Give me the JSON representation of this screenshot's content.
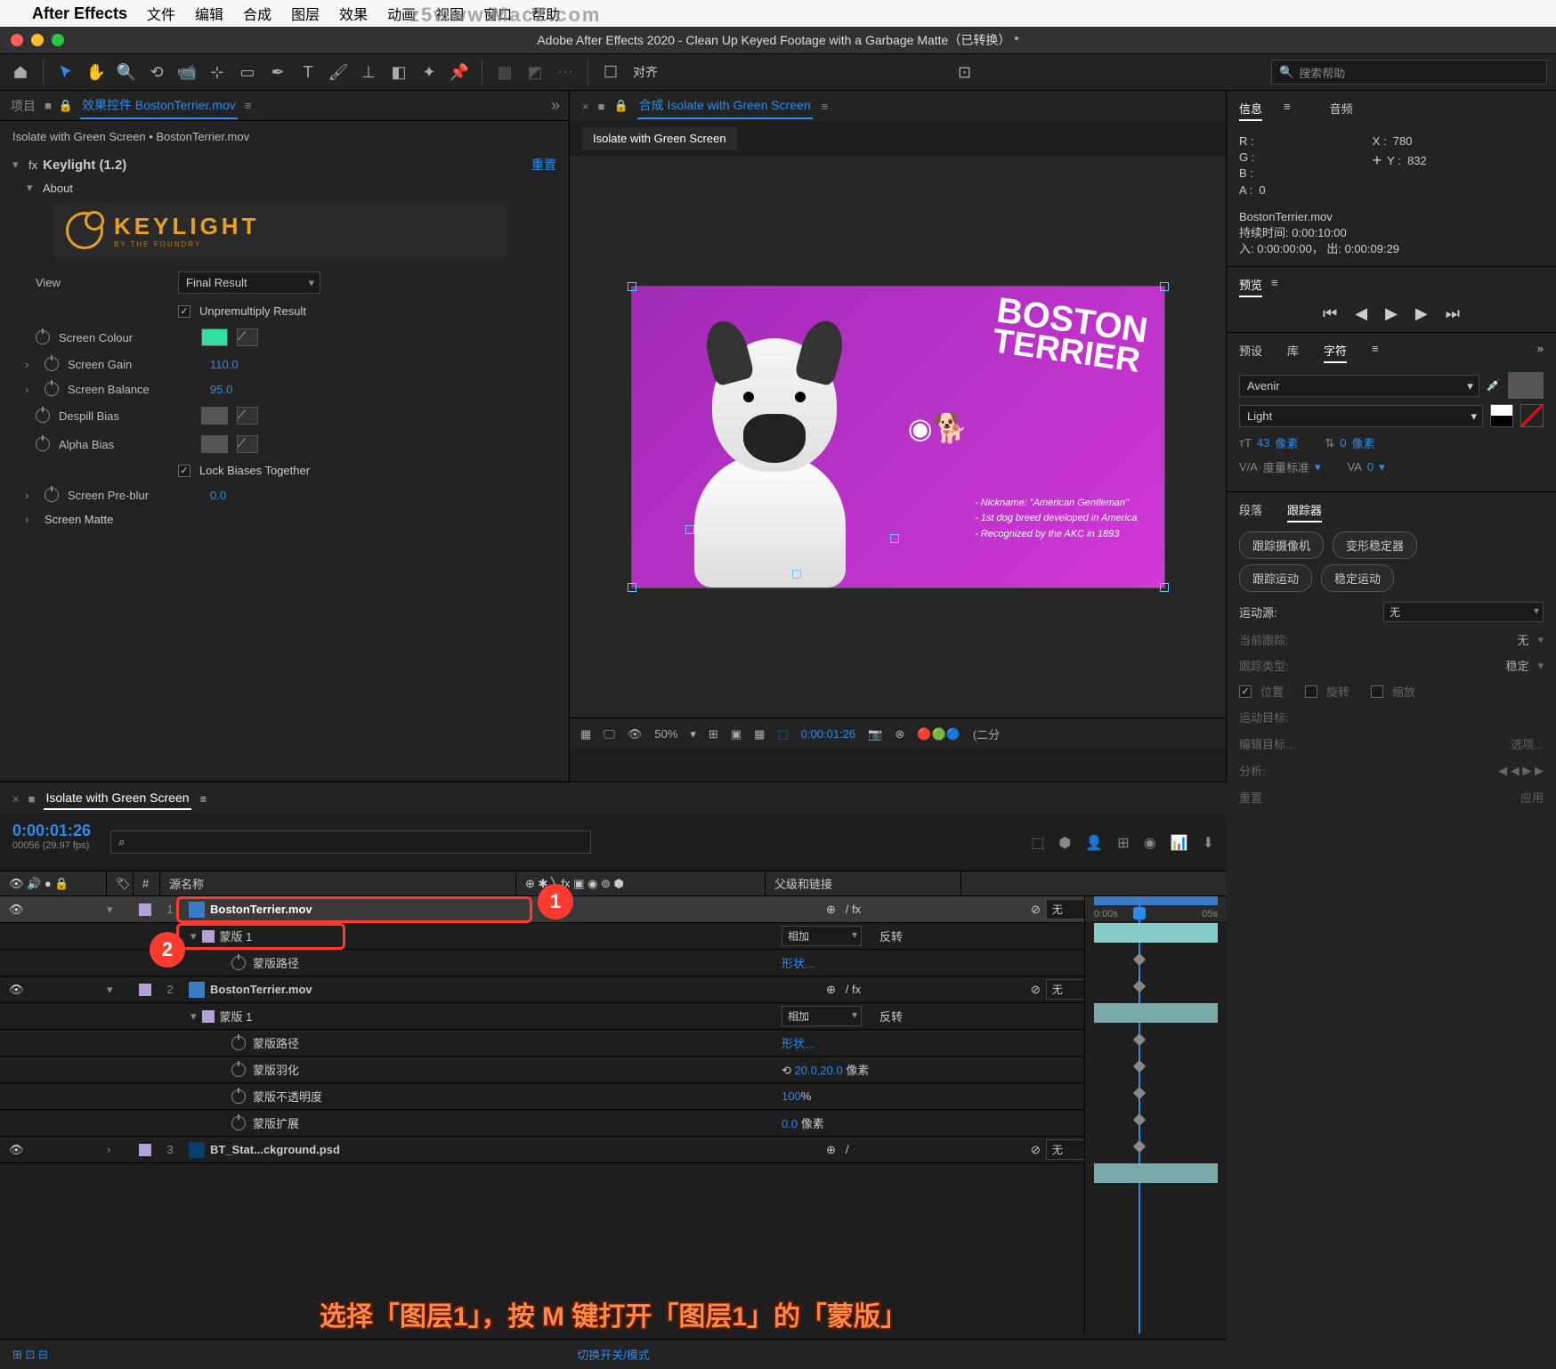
{
  "menubar": {
    "app": "After Effects",
    "items": [
      "文件",
      "编辑",
      "合成",
      "图层",
      "效果",
      "动画",
      "视图",
      "窗口",
      "帮助"
    ]
  },
  "watermark": "z5www.MacZ.com",
  "window": {
    "title": "Adobe After Effects 2020 - Clean Up Keyed Footage with a Garbage Matte（已转换） *"
  },
  "toolbar": {
    "align": "对齐",
    "search_placeholder": "搜索帮助",
    "search_icon": "🔍"
  },
  "project_panel": {
    "tab_project": "项目",
    "tab_effects": "效果控件 BostonTerrier.mov",
    "lock": "🔒",
    "menu": "≡",
    "expand": "»"
  },
  "effects": {
    "breadcrumb": "Isolate with Green Screen • BostonTerrier.mov",
    "fx_name": "Keylight (1.2)",
    "reset": "重置",
    "about": "About",
    "logo": "KEYLIGHT",
    "logo_sub": "BY THE FOUNDRY",
    "view_label": "View",
    "view_value": "Final Result",
    "unpremult": "Unpremultiply Result",
    "screen_colour": "Screen Colour",
    "screen_colour_hex": "#33e0a0",
    "screen_gain": "Screen Gain",
    "screen_gain_v": "110.0",
    "screen_balance": "Screen Balance",
    "screen_balance_v": "95.0",
    "despill": "Despill Bias",
    "alpha_bias": "Alpha Bias",
    "lock_biases": "Lock Biases Together",
    "preblur": "Screen Pre-blur",
    "preblur_v": "0.0",
    "screen_matte": "Screen Matte"
  },
  "comp": {
    "tab": "合成 Isolate with Green Screen",
    "lock": "🔒",
    "menu": "≡",
    "crumb": "Isolate with Green Screen",
    "title1": "BOSTON",
    "title2": "TERRIER",
    "fact1": "- Nickname: \"American Gentleman\"",
    "fact2": "- 1st dog breed developed in America",
    "fact3": "- Recognized by the AKC in 1893",
    "zoom": "50%",
    "time": "0:00:01:26",
    "extra": "(二分"
  },
  "info": {
    "tab_info": "信息",
    "tab_audio": "音频",
    "R": "R :",
    "G": "G :",
    "B": "B :",
    "A": "A :",
    "A_v": "0",
    "X": "X :",
    "Xv": "780",
    "Y": "Y :",
    "Yv": "832",
    "src": "BostonTerrier.mov",
    "dur_l": "持续时间:",
    "dur": "0:00:10:00",
    "in_l": "入:",
    "in": "0:00:00:00，",
    "out_l": "出:",
    "out": "0:00:09:29"
  },
  "preview": {
    "tab": "预览",
    "menu": "≡"
  },
  "char_tabs": {
    "preset": "预设",
    "lib": "库",
    "char": "字符",
    "menu": "≡"
  },
  "char": {
    "font": "Avenir",
    "weight": "Light",
    "size": "43",
    "size_u": "像素",
    "lead": "0",
    "lead_u": "像素",
    "track_l": "度量标准",
    "track": "0"
  },
  "para": {
    "tab_para": "段落",
    "tab_track": "跟踪器"
  },
  "track": {
    "btn1": "跟踪摄像机",
    "btn2": "变形稳定器",
    "btn3": "跟踪运动",
    "btn4": "稳定运动",
    "src_l": "运动源:",
    "src_v": "无",
    "cur_l": "当前跟踪:",
    "cur_v": "无",
    "type_l": "跟踪类型:",
    "type_v": "稳定",
    "pos": "位置",
    "rot": "旋转",
    "scale": "缩放",
    "target_l": "运动目标:",
    "edit": "编辑目标...",
    "opts": "选项...",
    "analyze": "分析:",
    "reset": "重置",
    "apply": "应用"
  },
  "timeline": {
    "tab": "Isolate with Green Screen",
    "menu": "≡",
    "time": "0:00:01:26",
    "fps": "00056 (29.97 fps)",
    "search": "⌕",
    "col_num": "#",
    "col_src": "源名称",
    "col_parent": "父级和链接",
    "ruler": [
      "0:00s",
      "05s"
    ],
    "layers": [
      {
        "num": "1",
        "name": "BostonTerrier.mov",
        "parent": "无",
        "mask": "蒙版 1",
        "mask_mode": "相加",
        "mask_invert": "反转",
        "mask_path_l": "蒙版路径",
        "mask_path_v": "形状..."
      },
      {
        "num": "2",
        "name": "BostonTerrier.mov",
        "parent": "无",
        "mask": "蒙版 1",
        "mask_mode": "相加",
        "mask_invert": "反转",
        "mask_path_l": "蒙版路径",
        "mask_path_v": "形状...",
        "feather_l": "蒙版羽化",
        "feather_v": "20.0,20.0",
        "feather_u": "像素",
        "opacity_l": "蒙版不透明度",
        "opacity_v": "100",
        "opacity_u": "%",
        "expand_l": "蒙版扩展",
        "expand_v": "0.0",
        "expand_u": "像素"
      },
      {
        "num": "3",
        "name": "BT_Stat...ckground.psd",
        "parent": "无"
      }
    ],
    "footer": "切换开关/模式"
  },
  "instruction": "选择「图层1」，按 M 键打开「图层1」的「蒙版」"
}
